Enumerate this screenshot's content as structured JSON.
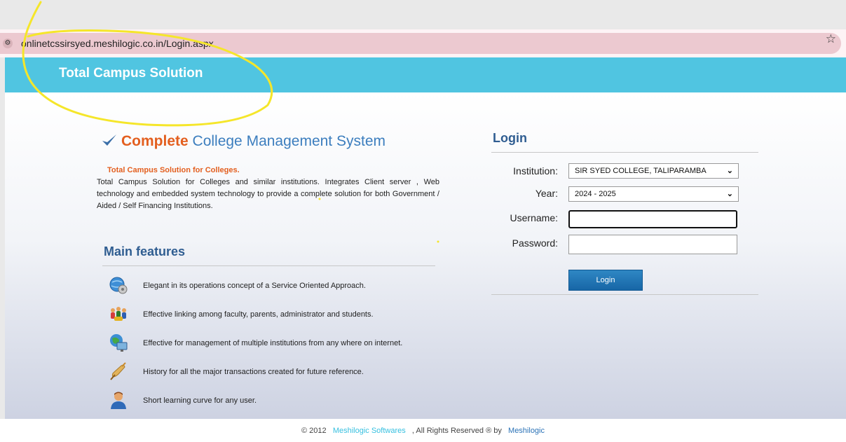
{
  "browser": {
    "url": "onlinetcssirsyed.meshilogic.co.in/Login.aspx",
    "site_info_glyph": "⚙",
    "bookmark_glyph": "☆"
  },
  "header": {
    "title": "Total Campus Solution"
  },
  "intro": {
    "headline_strong": "Complete",
    "headline_rest": " College Management System",
    "subtitle": "Total Campus Solution for Colleges.",
    "description": "Total Campus Solution for Colleges and similar institutions. Integrates Client server , Web technology and embedded system technology to provide a complete solution for both Government / Aided / Self Financing Institutions."
  },
  "features": {
    "heading": "Main features",
    "items": [
      {
        "icon": "gear-globe-icon",
        "text": "Elegant in its operations concept of a Service Oriented Approach."
      },
      {
        "icon": "people-icon",
        "text": "Effective linking among faculty, parents, administrator and students."
      },
      {
        "icon": "globe-monitor-icon",
        "text": "Effective for management of multiple institutions from any where on internet."
      },
      {
        "icon": "pen-scroll-icon",
        "text": "History for all the major transactions created for future reference."
      },
      {
        "icon": "user-icon",
        "text": "Short learning curve for any user."
      }
    ]
  },
  "login": {
    "title": "Login",
    "institution_label": "Institution:",
    "institution_value": "SIR SYED COLLEGE, TALIPARAMBA",
    "year_label": "Year:",
    "year_value": "2024 - 2025",
    "username_label": "Username:",
    "username_value": "",
    "password_label": "Password:",
    "password_value": "",
    "button_label": "Login"
  },
  "footer": {
    "prefix": "© 2012",
    "company_link": "Meshilogic Softwares",
    "middle": ", All Rights Reserved ® by",
    "brand_link": "Meshilogic"
  },
  "colors": {
    "header_bg": "#50c5e1",
    "accent_orange": "#e35f1f",
    "heading_blue": "#2f5d91",
    "button_blue": "#1766a6",
    "annotation_yellow": "#f5e62a"
  }
}
